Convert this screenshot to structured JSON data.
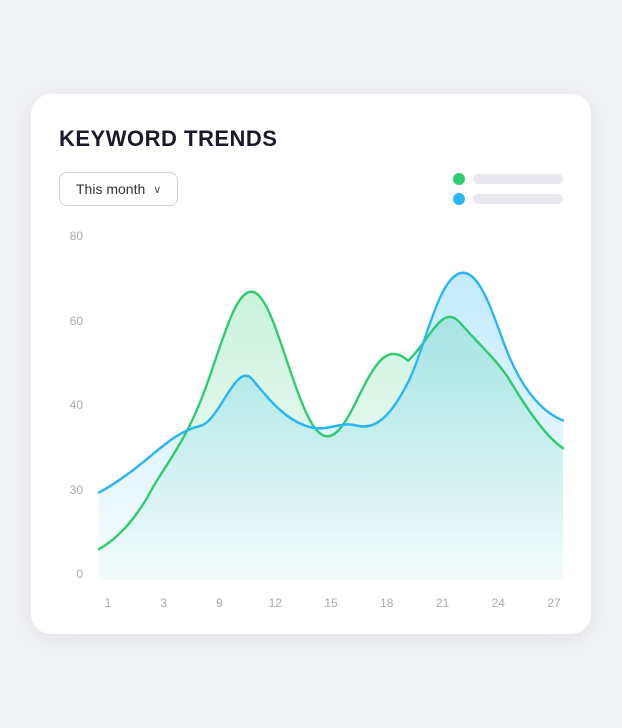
{
  "title": "KEYWORD TRENDS",
  "dropdown": {
    "label": "This month",
    "chevron": "∨"
  },
  "legend": [
    {
      "color": "#2ecc71",
      "bar_color": "#e0e0e8"
    },
    {
      "color": "#29b6f6",
      "bar_color": "#e0e0e8"
    }
  ],
  "y_axis": {
    "labels": [
      "80",
      "60",
      "40",
      "30",
      "0"
    ]
  },
  "x_axis": {
    "labels": [
      "1",
      "3",
      "9",
      "12",
      "15",
      "18",
      "21",
      "24",
      "27"
    ]
  },
  "colors": {
    "green": "#2ecc71",
    "blue": "#29b6f6",
    "green_fill_start": "rgba(46,204,113,0.18)",
    "green_fill_end": "rgba(46,204,113,0.02)",
    "blue_fill_start": "rgba(41,182,246,0.22)",
    "blue_fill_end": "rgba(41,182,246,0.02)"
  }
}
